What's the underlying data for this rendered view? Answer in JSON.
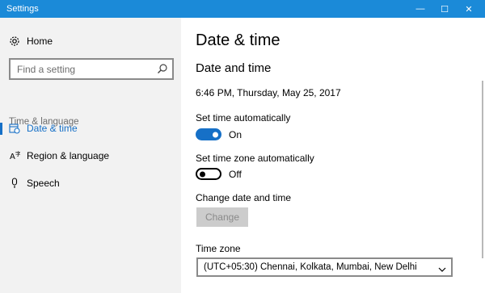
{
  "window": {
    "title": "Settings",
    "minimize_glyph": "—",
    "maximize_glyph": "☐",
    "close_glyph": "✕"
  },
  "sidebar": {
    "home_label": "Home",
    "search_placeholder": "Find a setting",
    "section_heading": "Time & language",
    "items": [
      {
        "label": "Date & time",
        "icon": "date-time-icon",
        "active": true
      },
      {
        "label": "Region & language",
        "icon": "region-language-icon",
        "active": false
      },
      {
        "label": "Speech",
        "icon": "microphone-icon",
        "active": false
      }
    ]
  },
  "main": {
    "page_title": "Date & time",
    "section_title": "Date and time",
    "current_datetime": "6:46 PM, Thursday, May 25, 2017",
    "set_time_auto_label": "Set time automatically",
    "set_time_auto_state": "On",
    "set_tz_auto_label": "Set time zone automatically",
    "set_tz_auto_state": "Off",
    "change_label": "Change date and time",
    "change_button": "Change",
    "timezone_label": "Time zone",
    "timezone_value": "(UTC+05:30) Chennai, Kolkata, Mumbai, New Delhi"
  },
  "colors": {
    "titlebar": "#1b8ad8",
    "accent": "#1670c7",
    "sidebar_bg": "#f2f2f2"
  }
}
